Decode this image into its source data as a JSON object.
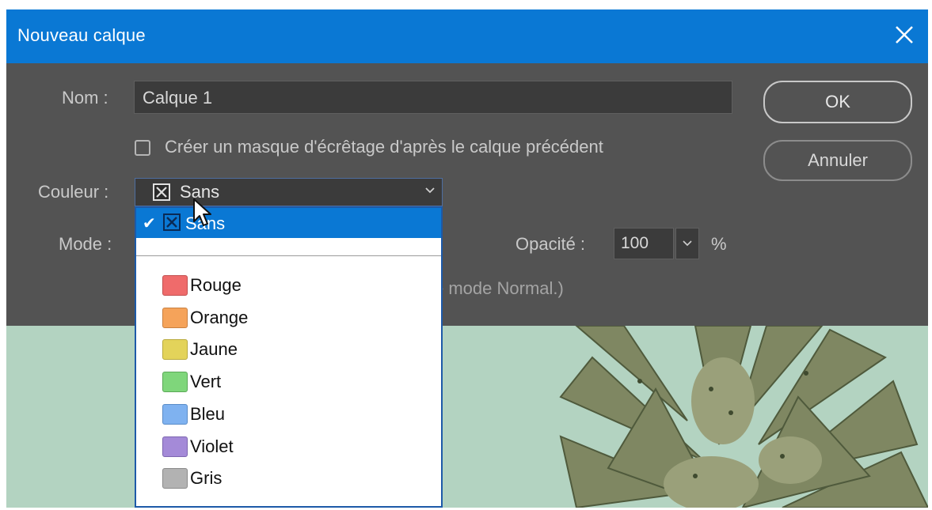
{
  "window": {
    "title": "Nouveau calque"
  },
  "form": {
    "name_label": "Nom :",
    "name_value": "Calque 1",
    "clip_label": "Créer un masque d'écrêtage d'après le calque précédent",
    "color_label": "Couleur :",
    "color_value": "Sans",
    "mode_label": "Mode :",
    "opacity_label": "Opacité :",
    "opacity_value": "100",
    "opacity_unit": "%",
    "hint_text": "e mode Normal.)"
  },
  "buttons": {
    "ok": "OK",
    "cancel": "Annuler"
  },
  "dropdown": {
    "selected": {
      "label": "Sans",
      "check": "✔"
    },
    "items": [
      {
        "label": "Rouge",
        "color": "#ef6b6b"
      },
      {
        "label": "Orange",
        "color": "#f5a35a"
      },
      {
        "label": "Jaune",
        "color": "#e3d35a"
      },
      {
        "label": "Vert",
        "color": "#7fd67b"
      },
      {
        "label": "Bleu",
        "color": "#7fb2f0"
      },
      {
        "label": "Violet",
        "color": "#a48ad8"
      },
      {
        "label": "Gris",
        "color": "#b2b2b2"
      }
    ]
  },
  "icons": {
    "close": "close-icon",
    "chevron": "chevron-down-icon",
    "none_swatch": "x-box-icon",
    "checkmark": "checkmark-icon",
    "cursor": "mouse-cursor-icon"
  },
  "colors": {
    "title_bar": "#0a78d4",
    "dialog_bg": "#535353",
    "selection": "#0a78d4",
    "background_photo": "#b3d3c1"
  }
}
